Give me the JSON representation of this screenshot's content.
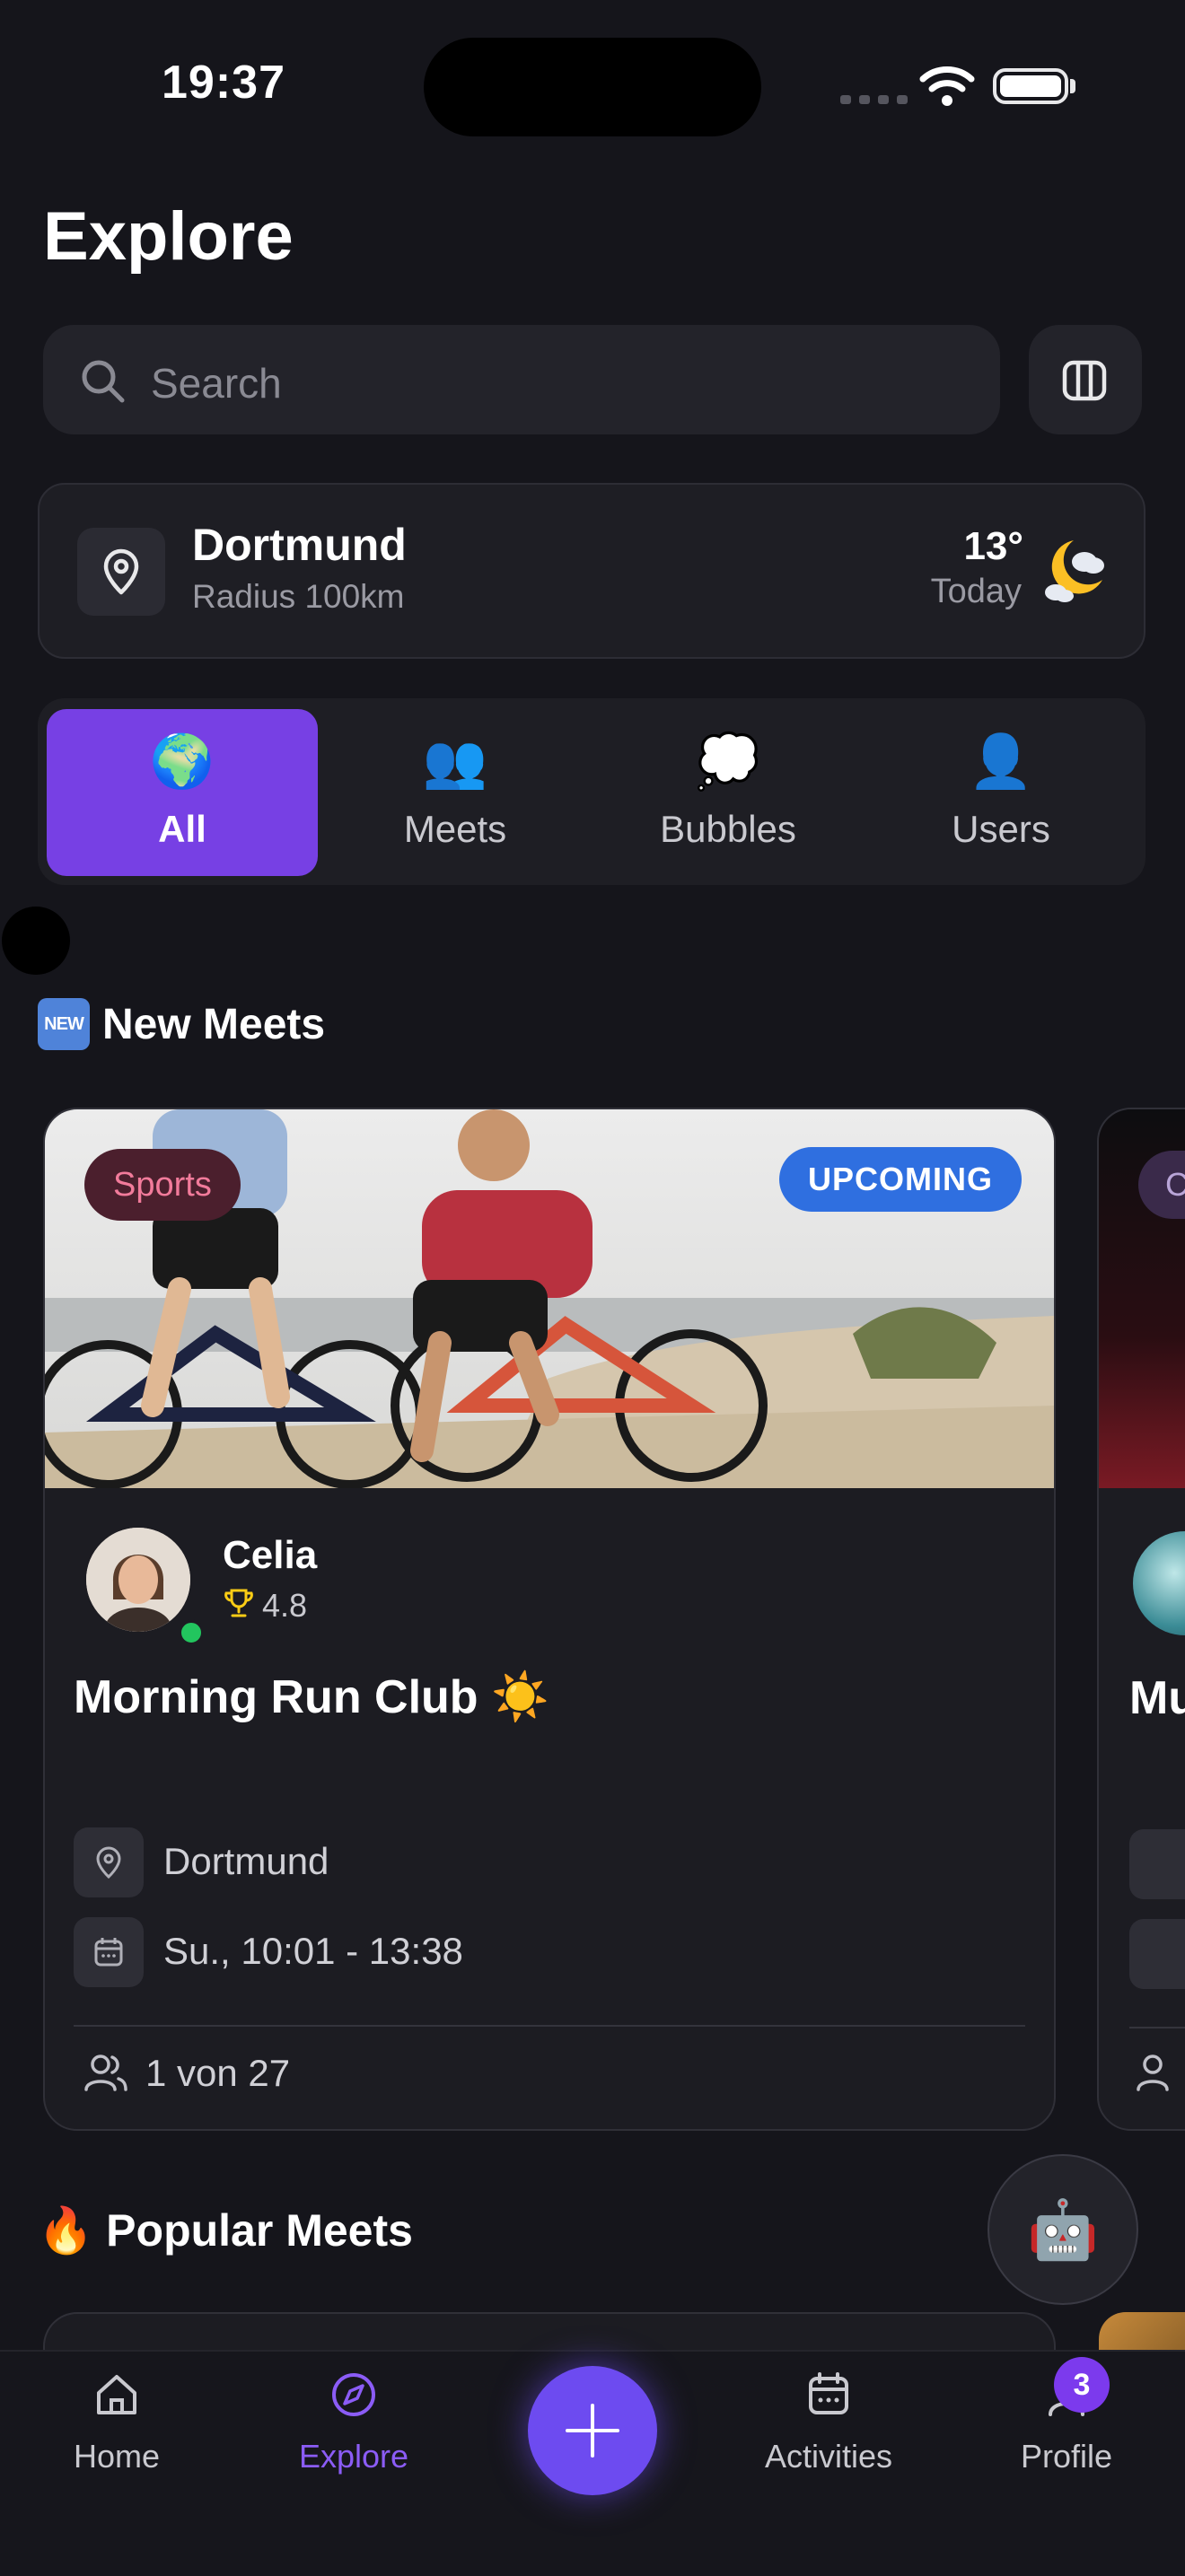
{
  "status_bar": {
    "time": "19:37"
  },
  "page": {
    "title": "Explore"
  },
  "search": {
    "placeholder": "Search"
  },
  "location": {
    "city": "Dortmund",
    "radius": "Radius 100km",
    "temperature": "13°",
    "day": "Today",
    "weather_icon": "moon-cloud-icon"
  },
  "tabs": [
    {
      "label": "All",
      "emoji": "🌍",
      "active": true
    },
    {
      "label": "Meets",
      "emoji": "👥",
      "active": false
    },
    {
      "label": "Bubbles",
      "emoji": "💭",
      "active": false
    },
    {
      "label": "Users",
      "emoji": "👤",
      "active": false
    }
  ],
  "sections": {
    "new_meets": {
      "badge": "NEW",
      "title": "New Meets"
    },
    "popular_meets": {
      "emoji": "🔥",
      "title": "Popular Meets"
    }
  },
  "meet_card": {
    "category": "Sports",
    "status": "UPCOMING",
    "host": {
      "name": "Celia",
      "rating": "4.8",
      "online": true
    },
    "title": "Morning Run Club ☀️",
    "location": "Dortmund",
    "datetime": "Su., 10:01 - 13:38",
    "participants": "1 von 27"
  },
  "peek_card": {
    "category_initial": "C",
    "title_fragment": "Mu"
  },
  "assistant": {
    "emoji": "🤖"
  },
  "bottom_nav": {
    "items": [
      {
        "label": "Home",
        "icon": "home-icon",
        "active": false
      },
      {
        "label": "Explore",
        "icon": "compass-icon",
        "active": true
      },
      {
        "label": "Activities",
        "icon": "calendar-icon",
        "active": false
      },
      {
        "label": "Profile",
        "icon": "profile-icon",
        "active": false
      }
    ],
    "profile_badge": "3",
    "create_icon": "plus-icon"
  },
  "colors": {
    "accent": "#7740e4",
    "background": "#15151b",
    "upcoming": "#2f6fe0",
    "online": "#22c55e"
  }
}
